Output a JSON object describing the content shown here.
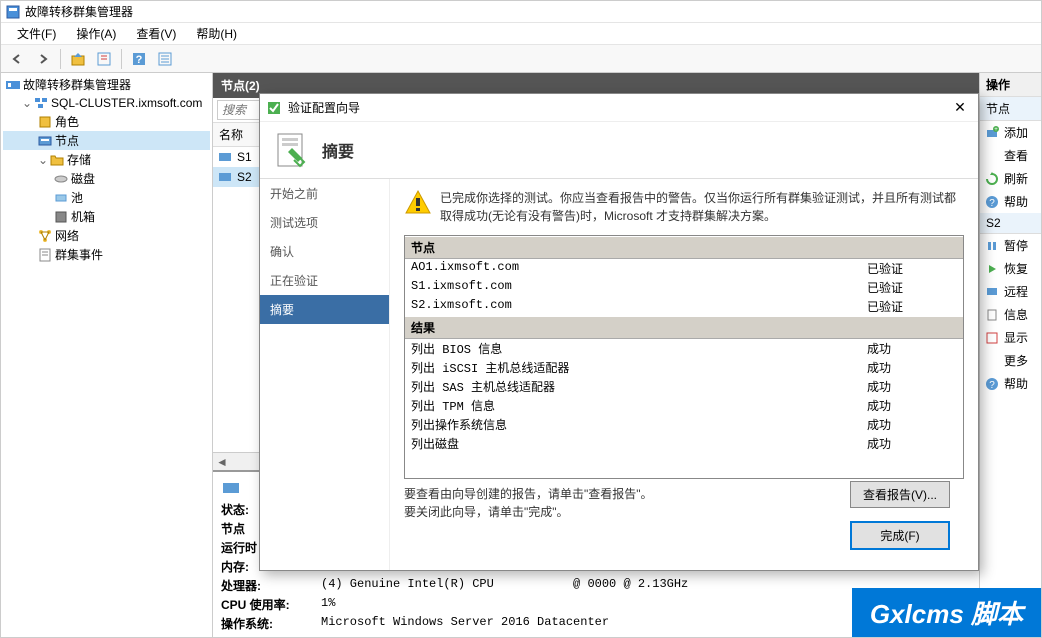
{
  "title": "故障转移群集管理器",
  "menus": {
    "file": "文件(F)",
    "action": "操作(A)",
    "view": "查看(V)",
    "help": "帮助(H)"
  },
  "tree": {
    "root": "故障转移群集管理器",
    "cluster": "SQL-CLUSTER.ixmsoft.com",
    "roles": "角色",
    "nodes": "节点",
    "storage": "存储",
    "disks": "磁盘",
    "pools": "池",
    "enclosures": "机箱",
    "networks": "网络",
    "events": "群集事件"
  },
  "center": {
    "header": "节点(2)",
    "search_placeholder": "搜索",
    "col_name": "名称",
    "rows": [
      "S1",
      "S2"
    ]
  },
  "details": {
    "status_label": "状态:",
    "node_label": "节点",
    "runtime_label": "运行时",
    "memory_label": "内存:",
    "cpu_label": "处理器:",
    "cpu_value": "(4) Genuine Intel(R) CPU           @ 0000 @ 2.13GHz",
    "cpu_usage_label": "CPU 使用率:",
    "cpu_usage_value": "1%",
    "os_label": "操作系统:",
    "os_value": "Microsoft Windows Server 2016 Datacenter"
  },
  "actions": {
    "header": "操作",
    "section_nodes": "节点",
    "add": "添加",
    "view": "查看",
    "refresh": "刷新",
    "help": "帮助",
    "section_s2": "S2",
    "pause": "暂停",
    "resume": "恢复",
    "remote": "远程",
    "info": "信息",
    "show": "显示",
    "more": "更多",
    "help2": "帮助"
  },
  "dialog": {
    "title": "验证配置向导",
    "header": "摘要",
    "nav": {
      "before": "开始之前",
      "options": "测试选项",
      "confirm": "确认",
      "validating": "正在验证",
      "summary": "摘要"
    },
    "warning": "已完成你选择的测试。你应当查看报告中的警告。仅当你运行所有群集验证测试，并且所有测试都取得成功(无论有没有警告)时，Microsoft 才支持群集解决方案。",
    "result_nodes_header": "节点",
    "result_results_header": "结果",
    "status_validated": "已验证",
    "status_success": "成功",
    "nodes": [
      {
        "name": "AO1.ixmsoft.com",
        "status": "已验证"
      },
      {
        "name": "S1.ixmsoft.com",
        "status": "已验证"
      },
      {
        "name": "S2.ixmsoft.com",
        "status": "已验证"
      }
    ],
    "results": [
      {
        "name": "列出 BIOS 信息",
        "status": "成功"
      },
      {
        "name": "列出 iSCSI 主机总线适配器",
        "status": "成功"
      },
      {
        "name": "列出 SAS 主机总线适配器",
        "status": "成功"
      },
      {
        "name": "列出 TPM 信息",
        "status": "成功"
      },
      {
        "name": "列出操作系统信息",
        "status": "成功"
      },
      {
        "name": "列出磁盘",
        "status": "成功"
      }
    ],
    "instructions1": "要查看由向导创建的报告，请单击\"查看报告\"。",
    "instructions2": "要关闭此向导，请单击\"完成\"。",
    "view_report": "查看报告(V)...",
    "finish": "完成(F)"
  },
  "watermark": "Gxlcms 脚本"
}
